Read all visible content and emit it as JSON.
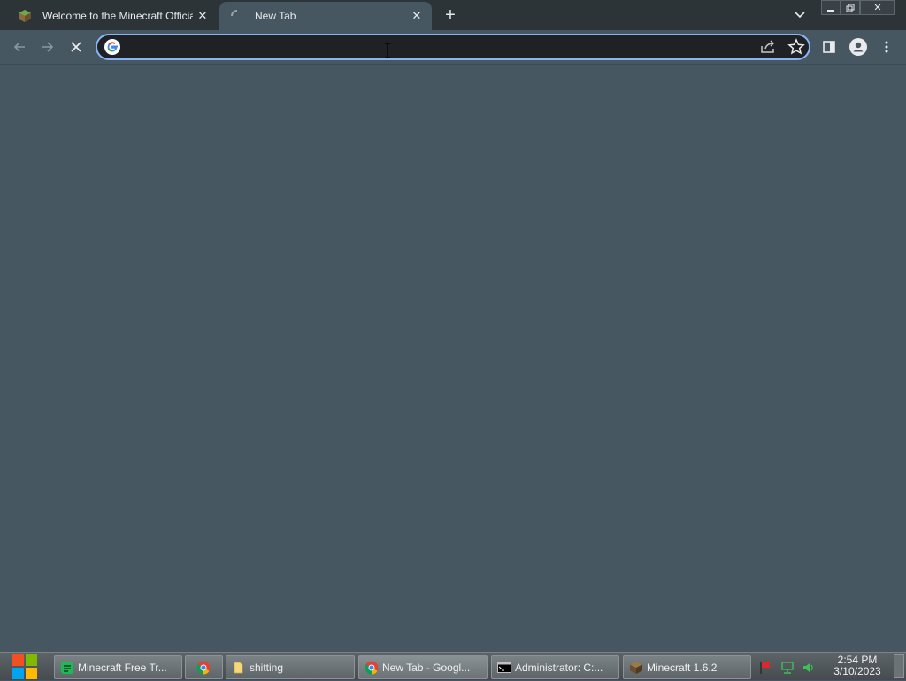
{
  "browser": {
    "tabs": [
      {
        "title": "Welcome to the Minecraft Official",
        "icon": "minecraft-grass-block-icon",
        "active": false
      },
      {
        "title": "New Tab",
        "icon": "loading-spinner-icon",
        "active": true
      }
    ],
    "new_tab_icon": "plus-icon",
    "tab_search_icon": "chevron-down-icon",
    "window_controls": [
      "minimize-icon",
      "restore-icon",
      "close-icon"
    ],
    "nav": {
      "back_icon": "back-arrow-icon",
      "forward_icon": "forward-arrow-icon",
      "stop_icon": "stop-loading-icon"
    },
    "omnibox": {
      "value": "",
      "placeholder": "",
      "engine_icon": "google-g-icon",
      "share_icon": "share-icon",
      "bookmark_icon": "star-icon"
    },
    "toolbar_right": [
      "side-panel-icon",
      "profile-icon",
      "menu-kebab-icon"
    ]
  },
  "taskbar": {
    "start_icon": "windows-logo-icon",
    "items": [
      {
        "label": "Minecraft Free Tr...",
        "icon": "app-green-icon",
        "active": false
      },
      {
        "label": "",
        "icon": "chrome-icon",
        "active": false
      },
      {
        "label": "shitting",
        "icon": "folder-icon",
        "active": false
      },
      {
        "label": "New Tab - Googl...",
        "icon": "chrome-icon",
        "active": true
      },
      {
        "label": "Administrator: C:...",
        "icon": "cmd-icon",
        "active": false
      },
      {
        "label": "Minecraft 1.6.2",
        "icon": "minecraft-icon",
        "active": false
      }
    ],
    "tray_icons": [
      "flag-icon",
      "network-icon",
      "volume-icon"
    ],
    "clock": {
      "time": "2:54 PM",
      "date": "3/10/2023"
    }
  },
  "colors": {
    "titlebar": "#2c3438",
    "content": "#465761",
    "omnibox_bg": "#202124",
    "omnibox_border": "#8ab4f8"
  }
}
